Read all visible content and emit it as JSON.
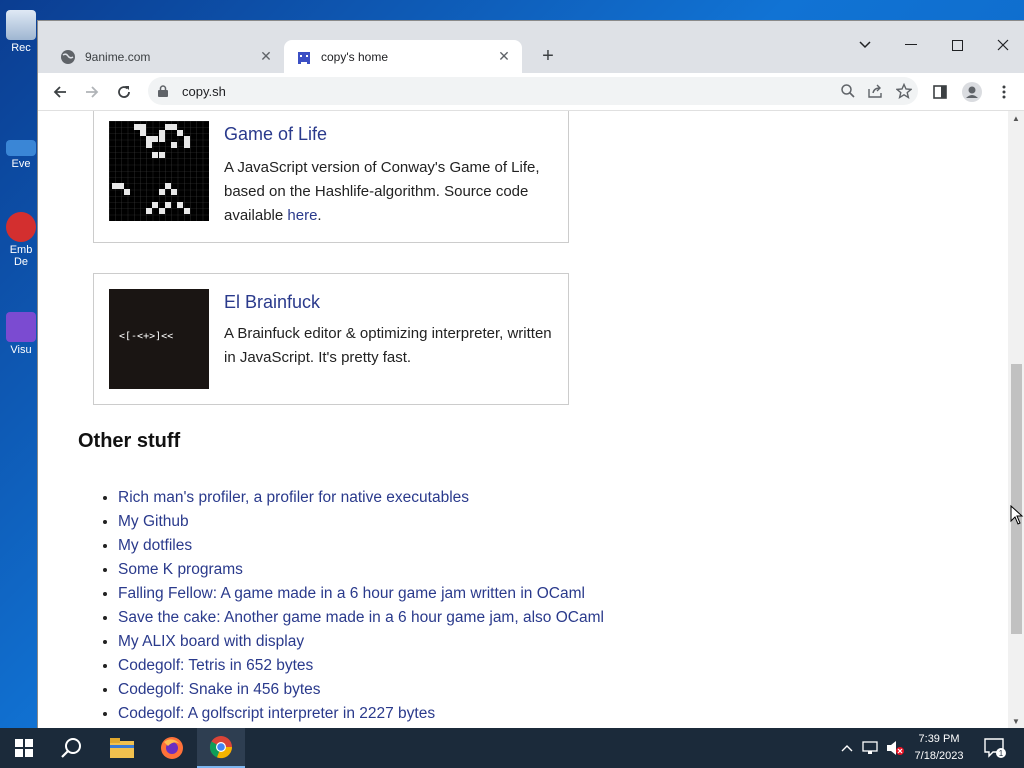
{
  "browser": {
    "tabs": [
      {
        "title": "9anime.com",
        "active": false
      },
      {
        "title": "copy's home",
        "active": true
      }
    ],
    "url": "copy.sh"
  },
  "projects": [
    {
      "title": "Game of Life",
      "desc_before": "A JavaScript version of Conway's Game of Life, based on the Hashlife-algorithm. Source code available ",
      "link": "here",
      "desc_after": "."
    },
    {
      "title": "El Brainfuck",
      "desc_before": "A Brainfuck editor & optimizing interpreter, written in JavaScript. It's pretty fast.",
      "code_lines": [
        "<[-<+>]<<",
        "",
        "<<",
        "[>>+<<-]",
        ">>"
      ]
    }
  ],
  "other": {
    "heading": "Other stuff",
    "links": [
      "Rich man's profiler, a profiler for native executables",
      "My Github",
      "My dotfiles",
      "Some K programs",
      "Falling Fellow: A game made in a 6 hour game jam written in OCaml",
      "Save the cake: Another game made in a 6 hour game jam, also OCaml",
      "My ALIX board with display",
      "Codegolf: Tetris in 652 bytes",
      "Codegolf: Snake in 456 bytes",
      "Codegolf: A golfscript interpreter in 2227 bytes"
    ]
  },
  "desktop_icons": [
    "Rec",
    "Eve",
    "Emb De",
    "Visu"
  ],
  "clock": {
    "time": "7:39 PM",
    "date": "7/18/2023"
  },
  "colors": {
    "link": "#2a3a8c",
    "tabstrip": "#dee1e6",
    "taskbar": "#1b2a3a"
  }
}
